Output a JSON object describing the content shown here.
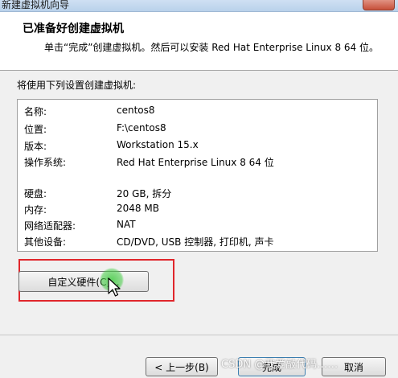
{
  "window": {
    "title": "新建虚拟机向导"
  },
  "header": {
    "heading": "已准备好创建虚拟机",
    "subtext": "单击“完成”创建虚拟机。然后可以安装 Red Hat Enterprise Linux 8 64 位。"
  },
  "intro": "将使用下列设置创建虚拟机:",
  "summary": {
    "rows": [
      {
        "label": "名称:",
        "value": "centos8"
      },
      {
        "label": "位置:",
        "value": "F:\\centos8"
      },
      {
        "label": "版本:",
        "value": "Workstation 15.x"
      },
      {
        "label": "操作系统:",
        "value": "Red Hat Enterprise Linux 8 64 位"
      },
      {
        "label": "硬盘:",
        "value": "20 GB, 拆分"
      },
      {
        "label": "内存:",
        "value": "2048 MB"
      },
      {
        "label": "网络适配器:",
        "value": "NAT"
      },
      {
        "label": "其他设备:",
        "value": "CD/DVD, USB 控制器, 打印机, 声卡"
      }
    ]
  },
  "buttons": {
    "customize": "自定义硬件(C)...",
    "back": "< 上一步(B)",
    "finish": "完成",
    "cancel": "取消"
  },
  "watermark": "CSDN @我爱敲代码……"
}
